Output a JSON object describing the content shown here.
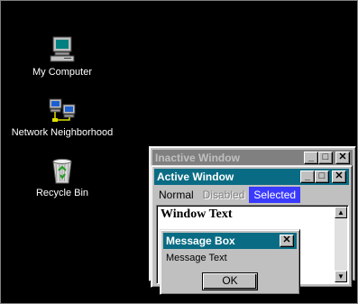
{
  "desktop": {
    "background": "#000000",
    "icons": [
      {
        "label": "My Computer",
        "icon": "my-computer-icon"
      },
      {
        "label": "Network Neighborhood",
        "icon": "network-neighborhood-icon"
      },
      {
        "label": "Recycle Bin",
        "icon": "recycle-bin-icon"
      }
    ]
  },
  "inactive_window": {
    "title": "Inactive Window",
    "title_color": "#808080"
  },
  "active_window": {
    "title": "Active Window",
    "title_color": "#0a6c84",
    "menu": {
      "normal": "Normal",
      "disabled": "Disabled",
      "selected": "Selected"
    },
    "content_text": "Window Text"
  },
  "message_box": {
    "title": "Message Box",
    "text": "Message Text",
    "ok_label": "OK"
  },
  "controls": {
    "minimize": "_",
    "maximize": "□",
    "close": "✕",
    "scroll_up": "▲",
    "scroll_down": "▼"
  }
}
